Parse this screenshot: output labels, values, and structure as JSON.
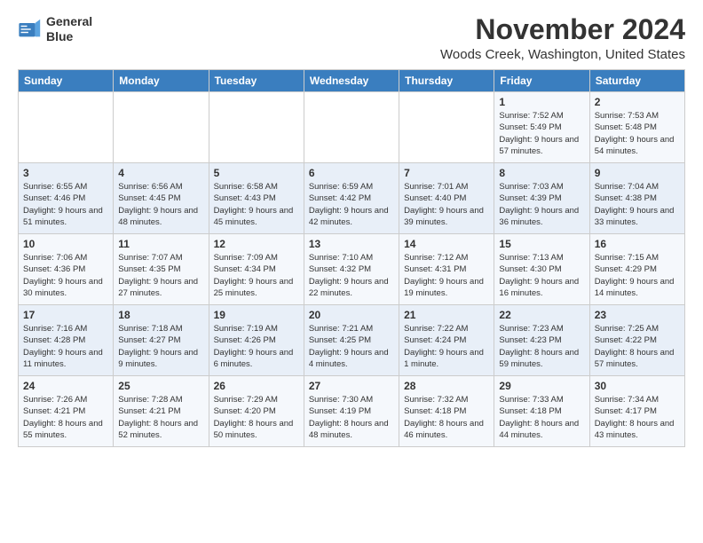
{
  "logo": {
    "line1": "General",
    "line2": "Blue"
  },
  "title": "November 2024",
  "location": "Woods Creek, Washington, United States",
  "days_of_week": [
    "Sunday",
    "Monday",
    "Tuesday",
    "Wednesday",
    "Thursday",
    "Friday",
    "Saturday"
  ],
  "weeks": [
    [
      {
        "day": "",
        "info": ""
      },
      {
        "day": "",
        "info": ""
      },
      {
        "day": "",
        "info": ""
      },
      {
        "day": "",
        "info": ""
      },
      {
        "day": "",
        "info": ""
      },
      {
        "day": "1",
        "info": "Sunrise: 7:52 AM\nSunset: 5:49 PM\nDaylight: 9 hours and 57 minutes."
      },
      {
        "day": "2",
        "info": "Sunrise: 7:53 AM\nSunset: 5:48 PM\nDaylight: 9 hours and 54 minutes."
      }
    ],
    [
      {
        "day": "3",
        "info": "Sunrise: 6:55 AM\nSunset: 4:46 PM\nDaylight: 9 hours and 51 minutes."
      },
      {
        "day": "4",
        "info": "Sunrise: 6:56 AM\nSunset: 4:45 PM\nDaylight: 9 hours and 48 minutes."
      },
      {
        "day": "5",
        "info": "Sunrise: 6:58 AM\nSunset: 4:43 PM\nDaylight: 9 hours and 45 minutes."
      },
      {
        "day": "6",
        "info": "Sunrise: 6:59 AM\nSunset: 4:42 PM\nDaylight: 9 hours and 42 minutes."
      },
      {
        "day": "7",
        "info": "Sunrise: 7:01 AM\nSunset: 4:40 PM\nDaylight: 9 hours and 39 minutes."
      },
      {
        "day": "8",
        "info": "Sunrise: 7:03 AM\nSunset: 4:39 PM\nDaylight: 9 hours and 36 minutes."
      },
      {
        "day": "9",
        "info": "Sunrise: 7:04 AM\nSunset: 4:38 PM\nDaylight: 9 hours and 33 minutes."
      }
    ],
    [
      {
        "day": "10",
        "info": "Sunrise: 7:06 AM\nSunset: 4:36 PM\nDaylight: 9 hours and 30 minutes."
      },
      {
        "day": "11",
        "info": "Sunrise: 7:07 AM\nSunset: 4:35 PM\nDaylight: 9 hours and 27 minutes."
      },
      {
        "day": "12",
        "info": "Sunrise: 7:09 AM\nSunset: 4:34 PM\nDaylight: 9 hours and 25 minutes."
      },
      {
        "day": "13",
        "info": "Sunrise: 7:10 AM\nSunset: 4:32 PM\nDaylight: 9 hours and 22 minutes."
      },
      {
        "day": "14",
        "info": "Sunrise: 7:12 AM\nSunset: 4:31 PM\nDaylight: 9 hours and 19 minutes."
      },
      {
        "day": "15",
        "info": "Sunrise: 7:13 AM\nSunset: 4:30 PM\nDaylight: 9 hours and 16 minutes."
      },
      {
        "day": "16",
        "info": "Sunrise: 7:15 AM\nSunset: 4:29 PM\nDaylight: 9 hours and 14 minutes."
      }
    ],
    [
      {
        "day": "17",
        "info": "Sunrise: 7:16 AM\nSunset: 4:28 PM\nDaylight: 9 hours and 11 minutes."
      },
      {
        "day": "18",
        "info": "Sunrise: 7:18 AM\nSunset: 4:27 PM\nDaylight: 9 hours and 9 minutes."
      },
      {
        "day": "19",
        "info": "Sunrise: 7:19 AM\nSunset: 4:26 PM\nDaylight: 9 hours and 6 minutes."
      },
      {
        "day": "20",
        "info": "Sunrise: 7:21 AM\nSunset: 4:25 PM\nDaylight: 9 hours and 4 minutes."
      },
      {
        "day": "21",
        "info": "Sunrise: 7:22 AM\nSunset: 4:24 PM\nDaylight: 9 hours and 1 minute."
      },
      {
        "day": "22",
        "info": "Sunrise: 7:23 AM\nSunset: 4:23 PM\nDaylight: 8 hours and 59 minutes."
      },
      {
        "day": "23",
        "info": "Sunrise: 7:25 AM\nSunset: 4:22 PM\nDaylight: 8 hours and 57 minutes."
      }
    ],
    [
      {
        "day": "24",
        "info": "Sunrise: 7:26 AM\nSunset: 4:21 PM\nDaylight: 8 hours and 55 minutes."
      },
      {
        "day": "25",
        "info": "Sunrise: 7:28 AM\nSunset: 4:21 PM\nDaylight: 8 hours and 52 minutes."
      },
      {
        "day": "26",
        "info": "Sunrise: 7:29 AM\nSunset: 4:20 PM\nDaylight: 8 hours and 50 minutes."
      },
      {
        "day": "27",
        "info": "Sunrise: 7:30 AM\nSunset: 4:19 PM\nDaylight: 8 hours and 48 minutes."
      },
      {
        "day": "28",
        "info": "Sunrise: 7:32 AM\nSunset: 4:18 PM\nDaylight: 8 hours and 46 minutes."
      },
      {
        "day": "29",
        "info": "Sunrise: 7:33 AM\nSunset: 4:18 PM\nDaylight: 8 hours and 44 minutes."
      },
      {
        "day": "30",
        "info": "Sunrise: 7:34 AM\nSunset: 4:17 PM\nDaylight: 8 hours and 43 minutes."
      }
    ]
  ]
}
